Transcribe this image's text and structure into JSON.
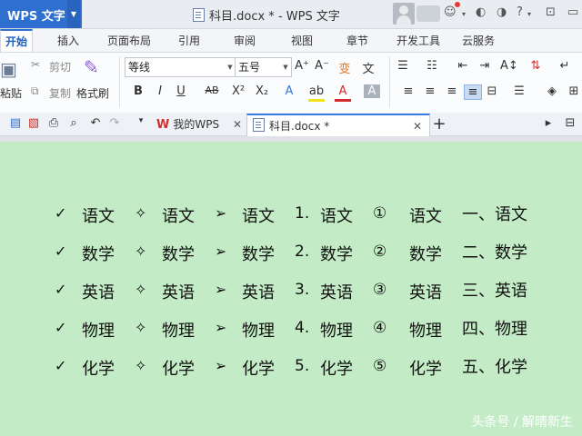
{
  "app": {
    "name": "WPS 文字",
    "window_title": "科目.docx * - WPS 文字"
  },
  "ribbon_tabs": [
    "开始",
    "插入",
    "页面布局",
    "引用",
    "审阅",
    "视图",
    "章节",
    "开发工具",
    "云服务"
  ],
  "ribbon": {
    "paste": "粘贴",
    "cut": "剪切",
    "copy": "复制",
    "format_painter": "格式刷",
    "font_name": "等线",
    "font_size": "五号",
    "clear_format": "变",
    "phonetic": "文"
  },
  "doc_tabs": [
    {
      "label": "我的WPS",
      "active": false
    },
    {
      "label": "科目.docx *",
      "active": true
    }
  ],
  "document": {
    "columns": [
      {
        "marker": "check",
        "labels": [
          "✓",
          "✓",
          "✓",
          "✓",
          "✓"
        ]
      },
      {
        "marker": "diamond",
        "labels": [
          "✧",
          "✧",
          "✧",
          "✧",
          "✧"
        ]
      },
      {
        "marker": "arrow",
        "labels": [
          "➢",
          "➢",
          "➢",
          "➢",
          "➢"
        ]
      },
      {
        "marker": "number",
        "labels": [
          "1.",
          "2.",
          "3.",
          "4.",
          "5."
        ]
      },
      {
        "marker": "circled",
        "labels": [
          "①",
          "②",
          "③",
          "④",
          "⑤"
        ]
      },
      {
        "marker": "chinese",
        "labels": [
          "一、",
          "二、",
          "三、",
          "四、",
          "五、"
        ]
      }
    ],
    "subjects": [
      "语文",
      "数学",
      "英语",
      "物理",
      "化学"
    ]
  },
  "watermark": "头条号 / 解晴新生"
}
